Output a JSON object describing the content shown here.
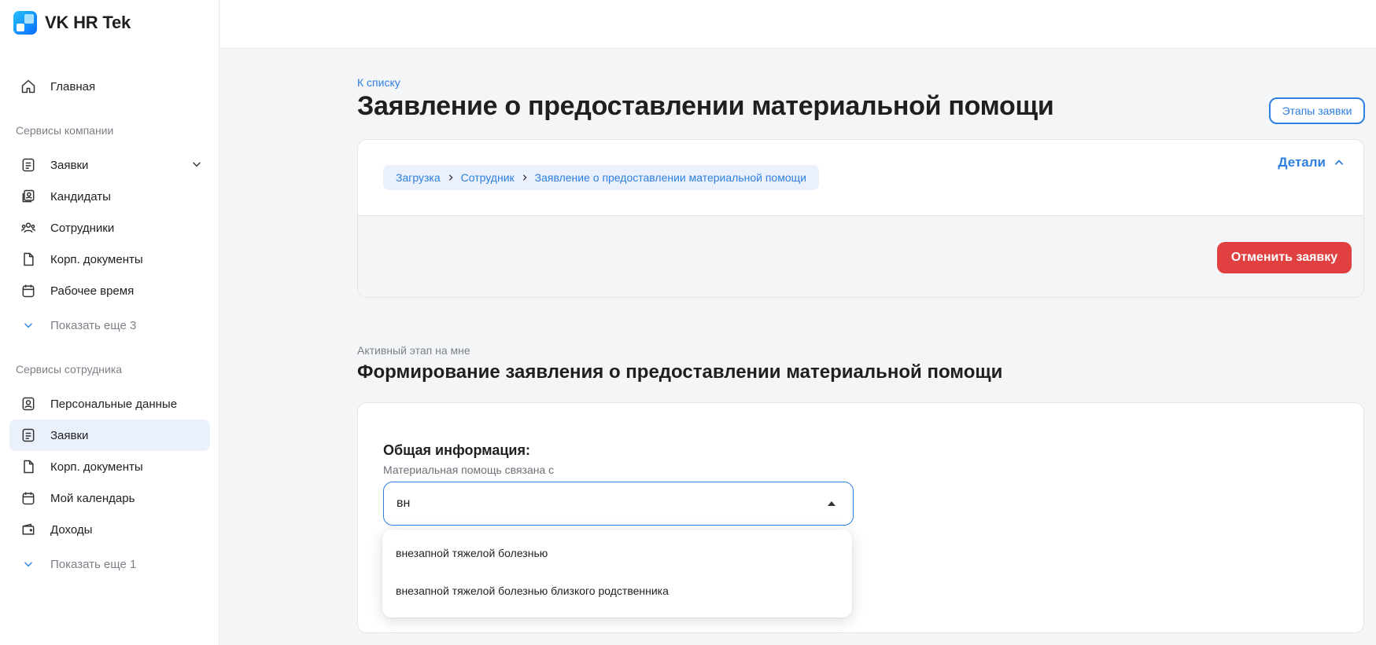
{
  "app": {
    "brand": "VK HR Tek"
  },
  "sidebar": {
    "main": {
      "label": "Главная",
      "icon": "home-icon"
    },
    "company_services_label": "Сервисы компании",
    "company_items": [
      {
        "label": "Заявки",
        "icon": "list-doc-icon"
      },
      {
        "label": "Кандидаты",
        "icon": "candidates-icon"
      },
      {
        "label": "Сотрудники",
        "icon": "people-icon"
      },
      {
        "label": "Корп. документы",
        "icon": "document-icon"
      },
      {
        "label": "Рабочее время",
        "icon": "calendar-icon"
      }
    ],
    "company_more": "Показать еще 3",
    "employee_services_label": "Сервисы сотрудника",
    "employee_items": [
      {
        "label": "Персональные данные",
        "icon": "profile-icon"
      },
      {
        "label": "Заявки",
        "icon": "list-doc-icon",
        "active": true
      },
      {
        "label": "Корп. документы",
        "icon": "document-icon"
      },
      {
        "label": "Мой календарь",
        "icon": "calendar-icon"
      },
      {
        "label": "Доходы",
        "icon": "wallet-icon"
      }
    ],
    "employee_more": "Показать еще 1"
  },
  "page": {
    "back_link": "К списку",
    "title": "Заявление о предоставлении материальной помощи",
    "stages_button": "Этапы заявки"
  },
  "request_card": {
    "breadcrumb": [
      "Загрузка",
      "Сотрудник",
      "Заявление о предоставлении материальной помощи"
    ],
    "details_toggle": "Детали",
    "cancel_button": "Отменить заявку"
  },
  "stage": {
    "label": "Активный этап на мне",
    "title": "Формирование заявления о предоставлении материальной помощи"
  },
  "form": {
    "section_heading": "Общая информация:",
    "field_label": "Материальная помощь связана с",
    "field_value": "вн",
    "options": [
      "внезапной тяжелой болезнью",
      "внезапной тяжелой болезнью близкого родственника"
    ]
  },
  "colors": {
    "accent": "#2d7fe0",
    "danger": "#e04040",
    "active_bg": "#eaf1fd"
  }
}
